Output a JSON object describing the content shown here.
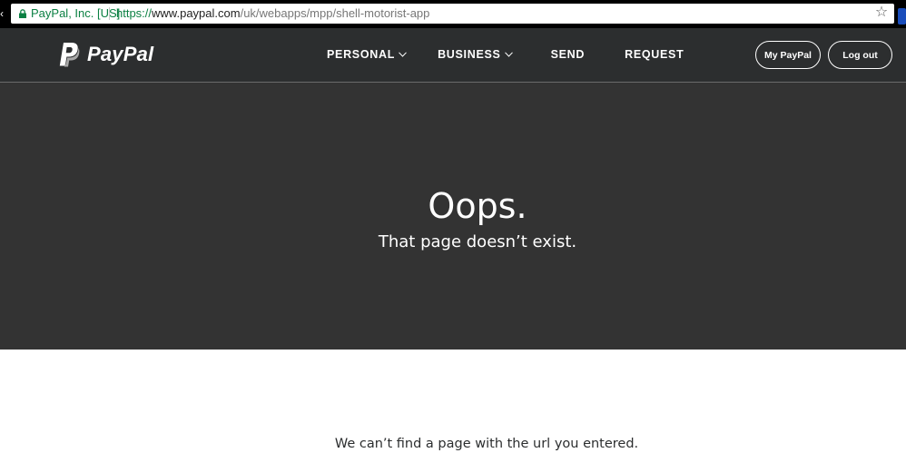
{
  "browser": {
    "site_identity": "PayPal, Inc. [US]",
    "url_scheme": "https://",
    "url_domain": "www.paypal.com",
    "url_path": "/uk/webapps/mpp/shell-motorist-app",
    "secure_color": "#0b8043"
  },
  "header": {
    "logo_text": "PayPal",
    "nav": {
      "personal": "PERSONAL",
      "business": "BUSINESS",
      "send": "SEND",
      "request": "REQUEST"
    },
    "my_paypal_label": "My PayPal",
    "logout_label": "Log out",
    "background_color": "#2c2e2f"
  },
  "hero": {
    "title": "Oops.",
    "subtitle": "That page doesn’t exist.",
    "background_color": "#333333"
  },
  "body": {
    "message": "We can’t find a page with the url you entered."
  },
  "icons": [
    "lock-icon",
    "star-icon",
    "paypal-logo-icon",
    "chevron-down-icon"
  ]
}
